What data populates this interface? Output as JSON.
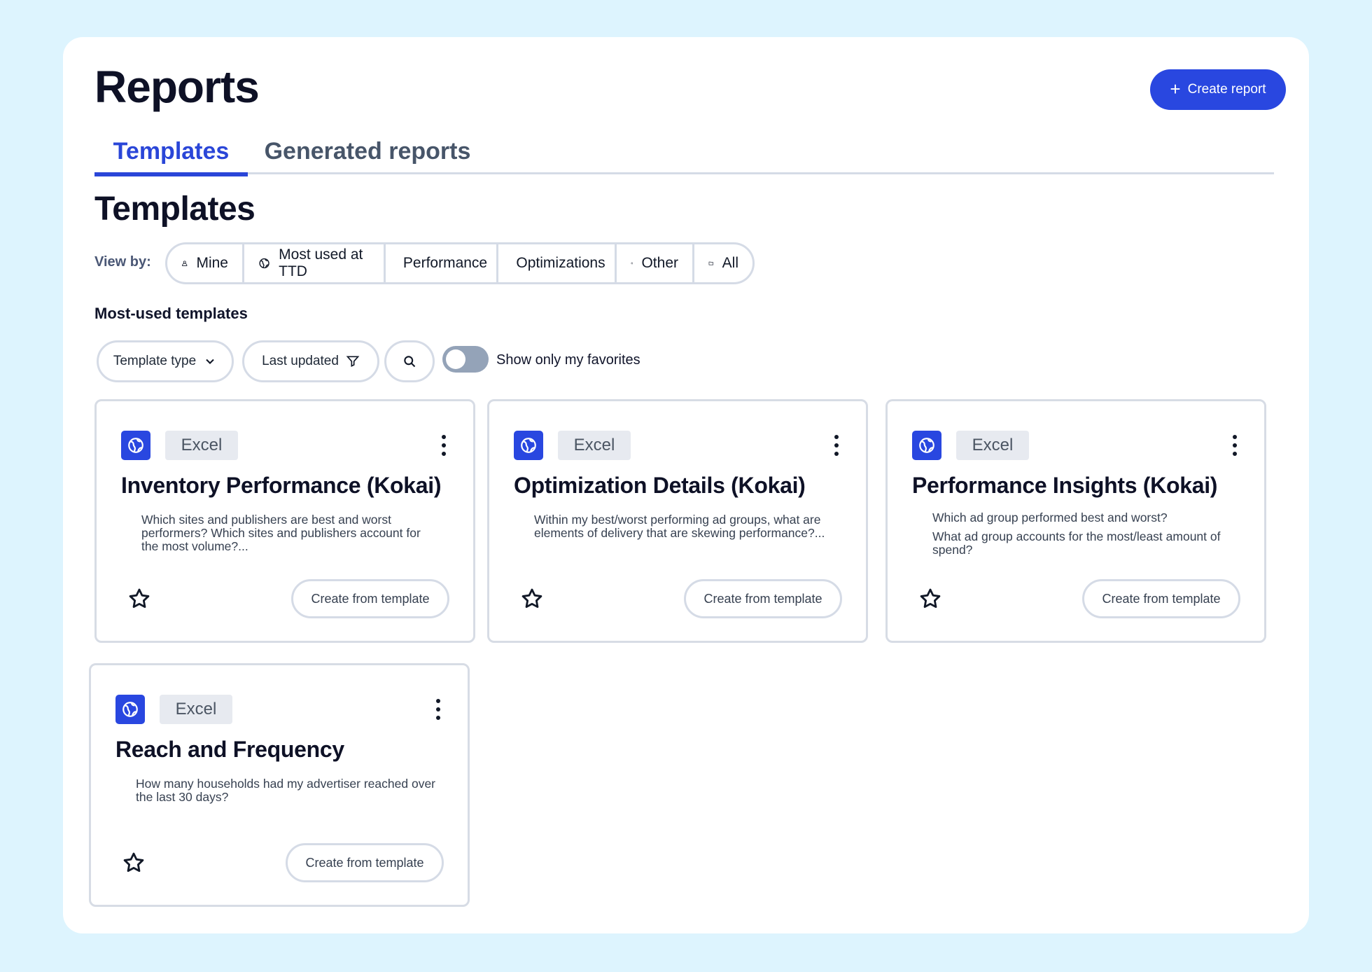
{
  "header": {
    "title": "Reports",
    "create_button_label": "Create report"
  },
  "tabs": [
    {
      "label": "Templates",
      "active": true
    },
    {
      "label": "Generated reports",
      "active": false
    }
  ],
  "section": {
    "title": "Templates",
    "view_by_label": "View by:",
    "view_by_options": [
      {
        "label": "Mine",
        "icon": "person-icon"
      },
      {
        "label": "Most used at TTD",
        "icon": "globe-icon"
      },
      {
        "label": "Performance",
        "icon": "line-chart-icon"
      },
      {
        "label": "Optimizations",
        "icon": "bar-chart-icon"
      },
      {
        "label": "Other",
        "icon": "network-icon"
      },
      {
        "label": "All",
        "icon": "folder-icon"
      }
    ]
  },
  "list": {
    "heading": "Most-used templates",
    "filters": {
      "template_type_label": "Template type",
      "last_updated_label": "Last updated",
      "favorites_toggle_label": "Show only my favorites",
      "favorites_toggle_on": false
    }
  },
  "cards": [
    {
      "badge": "Excel",
      "title": "Inventory Performance (Kokai)",
      "description": [
        "Which sites and publishers are best and worst performers? Which sites and publishers account for the most volume?..."
      ],
      "action_label": "Create from template"
    },
    {
      "badge": "Excel",
      "title": "Optimization Details (Kokai)",
      "description": [
        "Within my best/worst performing ad groups, what are elements of delivery that are skewing performance?..."
      ],
      "action_label": "Create from template"
    },
    {
      "badge": "Excel",
      "title": "Performance Insights (Kokai)",
      "description": [
        "Which ad group performed best and worst?",
        "What ad group accounts for the most/least amount of spend?"
      ],
      "action_label": "Create from template"
    },
    {
      "badge": "Excel",
      "title": "Reach and Frequency",
      "description": [
        "How many households had my advertiser reached over the last 30 days?"
      ],
      "action_label": "Create from template"
    }
  ],
  "colors": {
    "page_background": "#ddf4fe",
    "accent": "#2947e0",
    "border": "#d5dbe6"
  }
}
